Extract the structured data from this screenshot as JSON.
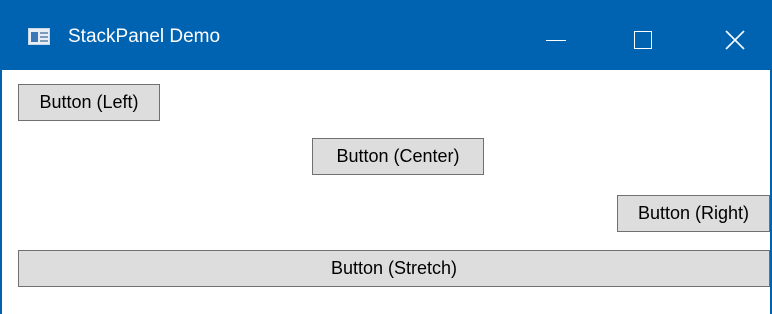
{
  "window": {
    "title": "StackPanel Demo",
    "app_icon": "window-app-icon",
    "controls": {
      "minimize_icon": "minimize-icon",
      "maximize_icon": "maximize-icon",
      "close_icon": "close-icon"
    }
  },
  "buttons": {
    "left": "Button (Left)",
    "center": "Button (Center)",
    "right": "Button (Right)",
    "stretch": "Button (Stretch)"
  },
  "colors": {
    "titlebar": "#0063b1",
    "button_face": "#dddddd",
    "button_border": "#707070"
  }
}
